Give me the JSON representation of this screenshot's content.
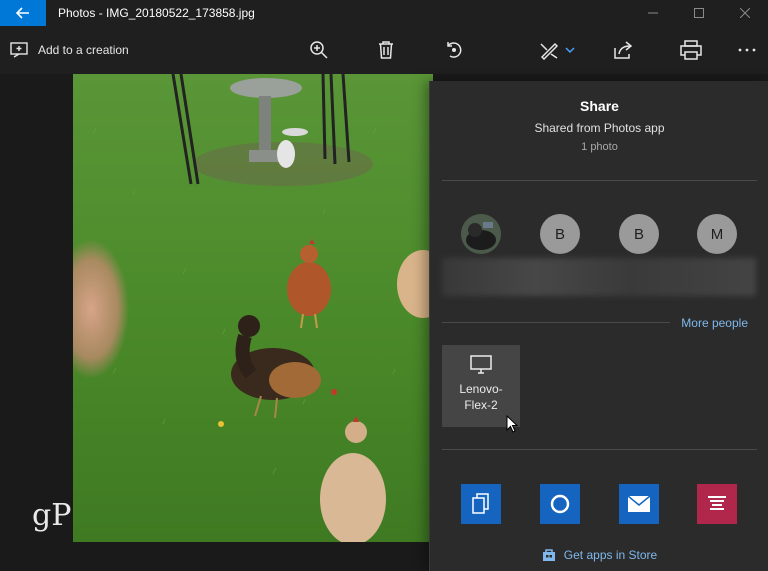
{
  "window": {
    "title": "Photos - IMG_20180522_173858.jpg",
    "controls": [
      "minimize",
      "maximize",
      "close"
    ]
  },
  "toolbar": {
    "add_to_creation": "Add to a creation",
    "icons": [
      "zoom-icon",
      "delete-icon",
      "rotate-icon",
      "edit-icon",
      "share-icon",
      "print-icon",
      "more-icon"
    ]
  },
  "share": {
    "title": "Share",
    "subtitle": "Shared from Photos app",
    "count": "1 photo",
    "people": [
      {
        "initial": "",
        "kind": "photo"
      },
      {
        "initial": "B",
        "kind": "letter"
      },
      {
        "initial": "B",
        "kind": "letter"
      },
      {
        "initial": "M",
        "kind": "letter"
      }
    ],
    "more_people": "More people",
    "device": {
      "label_line1": "Lenovo-",
      "label_line2": "Flex-2"
    },
    "apps": [
      {
        "name": "copy-app-icon",
        "color": "#1565c0"
      },
      {
        "name": "cortana-app-icon",
        "color": "#1565c0"
      },
      {
        "name": "mail-app-icon",
        "color": "#1565c0"
      },
      {
        "name": "onenote-app-icon",
        "color": "#b1264b"
      }
    ],
    "store": "Get apps in Store"
  },
  "watermark": "gP",
  "colors": {
    "accent": "#0078d7",
    "link": "#7fb8ec",
    "panel": "#2b2b2b",
    "background": "#1f1f1f"
  }
}
